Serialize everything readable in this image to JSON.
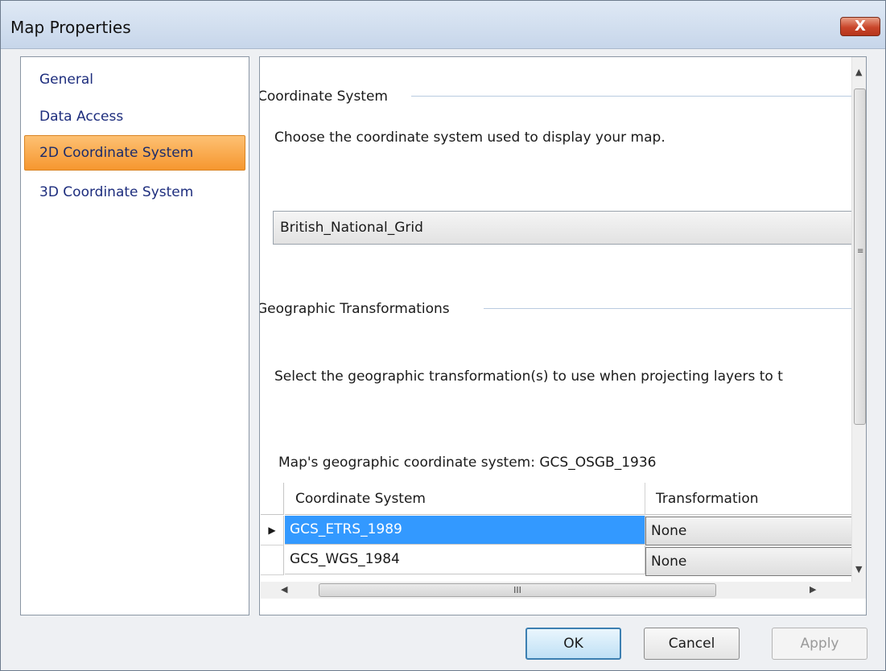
{
  "window": {
    "title": "Map Properties",
    "close_glyph": "X"
  },
  "nav": {
    "items": [
      {
        "label": "General"
      },
      {
        "label": "Data Access"
      },
      {
        "label": "2D Coordinate System"
      },
      {
        "label": "3D Coordinate System"
      }
    ],
    "selected": "2D Coordinate System"
  },
  "content": {
    "coord_section_title": "Coordinate System",
    "coord_description": "Choose the coordinate system used to display your map.",
    "coord_value": "British_National_Grid",
    "geo_section_title": "Geographic Transformations",
    "geo_description": "Select the geographic transformation(s) to use when projecting layers to t",
    "map_gcs_text": "Map's geographic coordinate system: GCS_OSGB_1936",
    "grid": {
      "columns": [
        "Coordinate System",
        "Transformation"
      ],
      "rows": [
        {
          "system": "GCS_ETRS_1989",
          "transformation": "None",
          "selected": true
        },
        {
          "system": "GCS_WGS_1984",
          "transformation": "None",
          "selected": false
        }
      ],
      "row_pointer_glyph": "▶"
    }
  },
  "scrollbar": {
    "grip": "III"
  },
  "buttons": {
    "ok": "OK",
    "cancel": "Cancel",
    "apply": "Apply"
  },
  "colors": {
    "selected_nav": "#f6972f",
    "selected_row": "#3399ff",
    "close": "#c9452a"
  }
}
